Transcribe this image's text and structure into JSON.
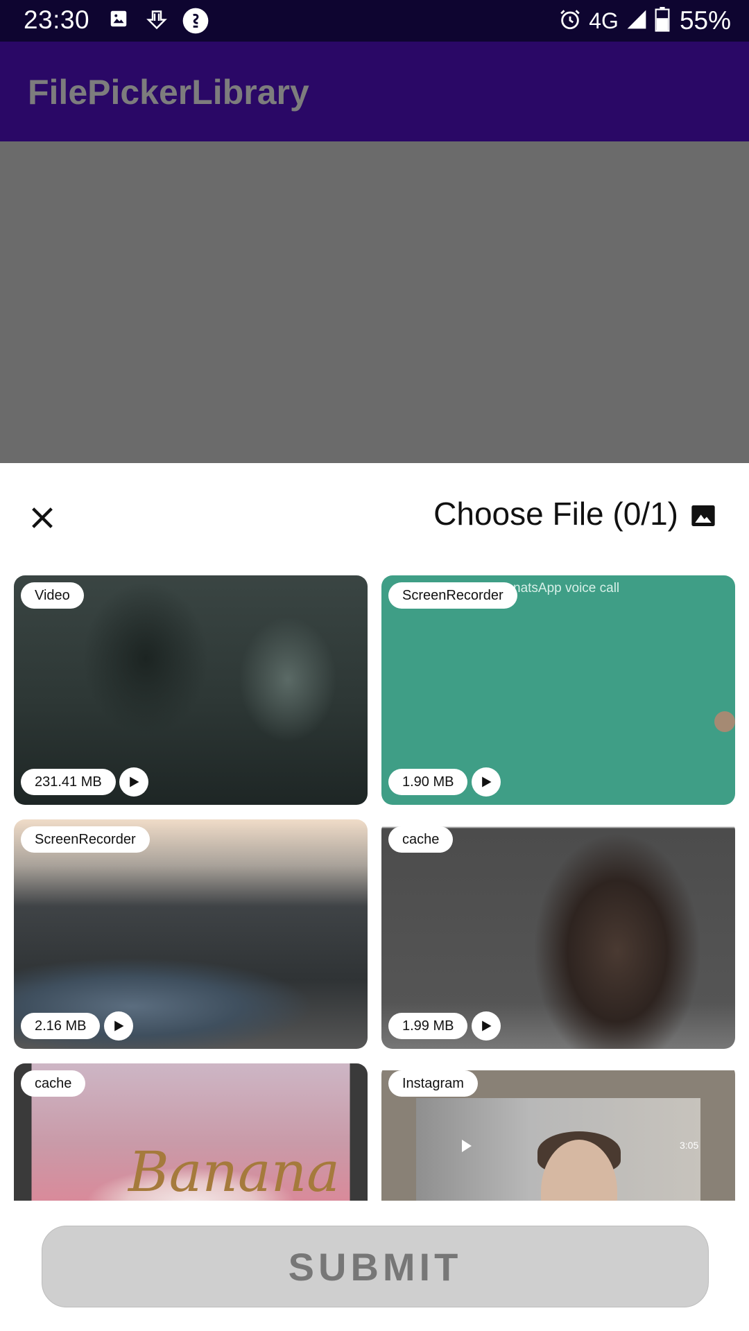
{
  "status_bar": {
    "time": "23:30",
    "network": "4G",
    "battery": "55%",
    "icons": [
      "image-icon",
      "download-icon",
      "app-icon",
      "alarm-icon",
      "signal-icon",
      "battery-icon"
    ]
  },
  "app_bar": {
    "title": "FilePickerLibrary"
  },
  "sheet": {
    "title": "Choose File (0/1)",
    "close_icon": "close-icon",
    "toggle_icon": "image-icon"
  },
  "tiles": [
    {
      "tag": "Video",
      "size": "231.41 MB",
      "is_video": true
    },
    {
      "tag": "ScreenRecorder",
      "size": "1.90 MB",
      "is_video": true,
      "overlay_text": "natsApp voice call"
    },
    {
      "tag": "ScreenRecorder",
      "size": "2.16 MB",
      "is_video": true
    },
    {
      "tag": "cache",
      "size": "1.99 MB",
      "is_video": true
    },
    {
      "tag": "cache",
      "overlay_text": "Banana"
    },
    {
      "tag": "Instagram",
      "overlay_text": "3:05"
    }
  ],
  "submit": {
    "label": "SUBMIT"
  },
  "colors": {
    "status_bar": "#0e0530",
    "app_bar": "#2a0866",
    "scrim": "#6b6b6b",
    "submit_bg": "#cfcfcf",
    "green_tile": "#3f9e86"
  }
}
